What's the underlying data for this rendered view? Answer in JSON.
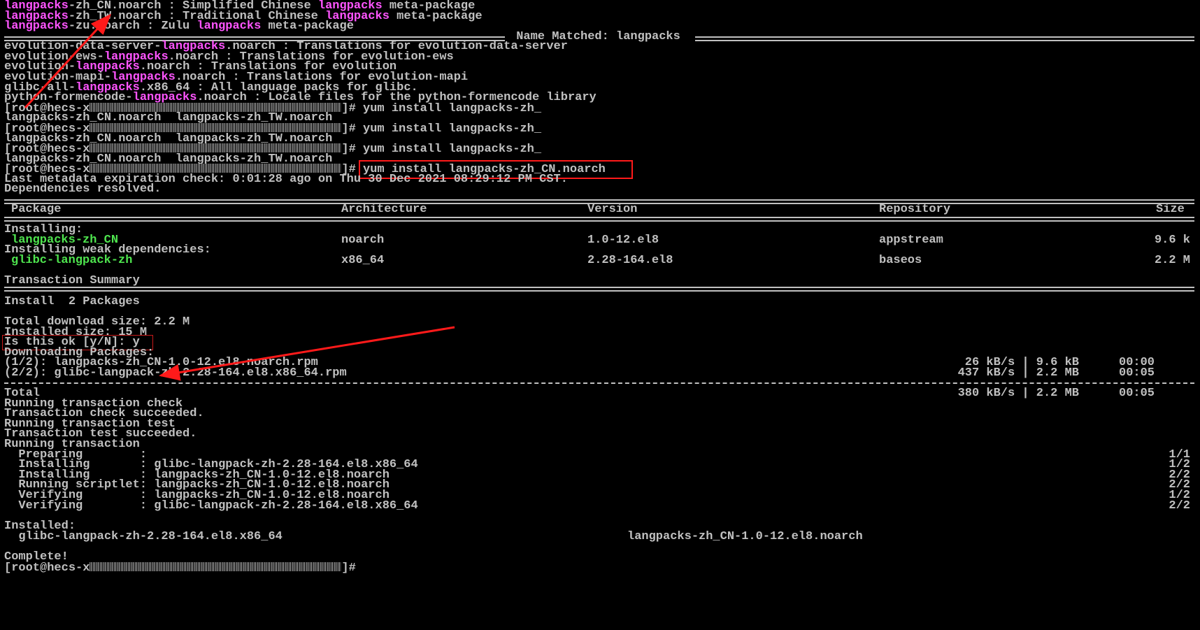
{
  "terminal": {
    "top_lines": [
      [
        {
          "t": "langpacks",
          "c": "hl"
        },
        {
          "t": "-zh_CN.noarch : Simplified Chinese ",
          "c": "default"
        },
        {
          "t": "langpacks",
          "c": "hl"
        },
        {
          "t": " meta-package",
          "c": "default"
        }
      ],
      [
        {
          "t": "langpacks",
          "c": "hl"
        },
        {
          "t": "-zh_TW.noarch : Traditional Chinese ",
          "c": "default"
        },
        {
          "t": "langpacks",
          "c": "hl"
        },
        {
          "t": " meta-package",
          "c": "default"
        }
      ],
      [
        {
          "t": "langpacks",
          "c": "hl"
        },
        {
          "t": "-zu.noarch : Zulu ",
          "c": "default"
        },
        {
          "t": "langpacks",
          "c": "hl"
        },
        {
          "t": " meta-package",
          "c": "default"
        }
      ]
    ],
    "name_matched": " Name Matched: langpacks ",
    "matched_lines": [
      [
        {
          "t": "evolution-data-server-",
          "c": "default"
        },
        {
          "t": "langpacks",
          "c": "hl"
        },
        {
          "t": ".noarch : Translations for evolution-data-server",
          "c": "default"
        }
      ],
      [
        {
          "t": "evolution-ews-",
          "c": "default"
        },
        {
          "t": "langpacks",
          "c": "hl"
        },
        {
          "t": ".noarch : Translations for evolution-ews",
          "c": "default"
        }
      ],
      [
        {
          "t": "evolution-",
          "c": "default"
        },
        {
          "t": "langpacks",
          "c": "hl"
        },
        {
          "t": ".noarch : Translations for evolution",
          "c": "default"
        }
      ],
      [
        {
          "t": "evolution-mapi-",
          "c": "default"
        },
        {
          "t": "langpacks",
          "c": "hl"
        },
        {
          "t": ".noarch : Translations for evolution-mapi",
          "c": "default"
        }
      ],
      [
        {
          "t": "glibc-all-",
          "c": "default"
        },
        {
          "t": "langpacks",
          "c": "hl"
        },
        {
          "t": ".x86_64 : All language packs for glibc.",
          "c": "default"
        }
      ],
      [
        {
          "t": "python-formencode-",
          "c": "default"
        },
        {
          "t": "langpacks",
          "c": "hl"
        },
        {
          "t": ".noarch : Locale files for the python-formencode library",
          "c": "default"
        }
      ]
    ],
    "prompt_prefix": "[root@hecs-x",
    "prompt_suffix": "]# ",
    "cmd_partial": "yum install langpacks-zh_",
    "cmd_full": "yum install langpacks-zh_CN.noarch",
    "completion_line": "langpacks-zh_CN.noarch  langpacks-zh_TW.noarch",
    "meta_line": "Last metadata expiration check: 0:01:28 ago on Thu 30 Dec 2021 08:29:12 PM CST.",
    "deps_line": "Dependencies resolved.",
    "table": {
      "headers": {
        "package": "Package",
        "arch": "Architecture",
        "version": "Version",
        "repo": "Repository",
        "size": "Size"
      },
      "installing_label": "Installing:",
      "weak_label": "Installing weak dependencies:",
      "rows": [
        {
          "package": "langpacks-zh_CN",
          "arch": "noarch",
          "version": "1.0-12.el8",
          "repo": "appstream",
          "size": "9.6 k"
        },
        {
          "package": "glibc-langpack-zh",
          "arch": "x86_64",
          "version": "2.28-164.el8",
          "repo": "baseos",
          "size": "2.2 M"
        }
      ]
    },
    "summary_title": "Transaction Summary",
    "install_count": "Install  2 Packages",
    "total_download": "Total download size: 2.2 M",
    "installed_size": "Installed size: 15 M",
    "confirm_prompt": "Is this ok [y/N]: y",
    "downloading": "Downloading Packages:",
    "downloads": [
      {
        "name": "(1/2): langpacks-zh_CN-1.0-12.el8.noarch.rpm",
        "rate": "26 kB/s | 9.6 kB",
        "time": "00:00"
      },
      {
        "name": "(2/2): glibc-langpack-zh-2.28-164.el8.x86_64.rpm",
        "rate": "437 kB/s | 2.2 MB",
        "time": "00:05"
      }
    ],
    "total": {
      "label": "Total",
      "rate": "380 kB/s | 2.2 MB",
      "time": "00:05"
    },
    "run_lines": [
      "Running transaction check",
      "Transaction check succeeded.",
      "Running transaction test",
      "Transaction test succeeded.",
      "Running transaction"
    ],
    "steps": [
      {
        "action": "  Preparing        :",
        "pkg": "",
        "count": "1/1"
      },
      {
        "action": "  Installing       :",
        "pkg": " glibc-langpack-zh-2.28-164.el8.x86_64",
        "count": "1/2"
      },
      {
        "action": "  Installing       :",
        "pkg": " langpacks-zh_CN-1.0-12.el8.noarch",
        "count": "2/2"
      },
      {
        "action": "  Running scriptlet:",
        "pkg": " langpacks-zh_CN-1.0-12.el8.noarch",
        "count": "2/2"
      },
      {
        "action": "  Verifying        :",
        "pkg": " langpacks-zh_CN-1.0-12.el8.noarch",
        "count": "1/2"
      },
      {
        "action": "  Verifying        :",
        "pkg": " glibc-langpack-zh-2.28-164.el8.x86_64",
        "count": "2/2"
      }
    ],
    "installed_label": "Installed:",
    "installed_pkgs": [
      "  glibc-langpack-zh-2.28-164.el8.x86_64",
      "langpacks-zh_CN-1.0-12.el8.noarch"
    ],
    "complete": "Complete!"
  },
  "colors": {
    "text": "#c0c0c0",
    "highlight": "#ff55ff",
    "package_green": "#4ee44e",
    "annotation_red": "#ff1a1a",
    "background": "#000000"
  }
}
